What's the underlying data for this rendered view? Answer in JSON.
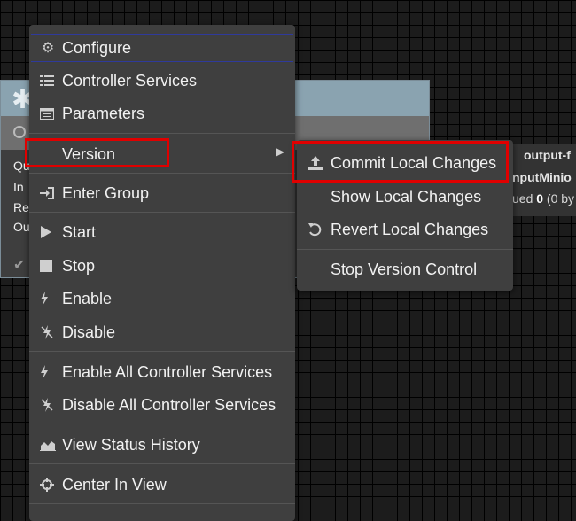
{
  "process_group": {
    "row_labels": [
      "Qu",
      "In",
      "Re",
      "Ou"
    ]
  },
  "connection": {
    "name": "output-f",
    "destination": "nputMinio",
    "queued_prefix": "ued ",
    "queued_value": "0",
    "queued_suffix": " (0 by"
  },
  "context_menu": {
    "items": [
      {
        "label": "Configure",
        "icon": "gear-icon"
      },
      {
        "label": "Controller Services",
        "icon": "list-icon"
      },
      {
        "label": "Parameters",
        "icon": "table-icon"
      },
      {
        "label": "Version",
        "icon": "none"
      },
      {
        "label": "Enter Group",
        "icon": "sign-in-icon"
      },
      {
        "label": "Start",
        "icon": "play-icon"
      },
      {
        "label": "Stop",
        "icon": "stop-icon"
      },
      {
        "label": "Enable",
        "icon": "bolt-icon"
      },
      {
        "label": "Disable",
        "icon": "bolt-slash-icon"
      },
      {
        "label": "Enable All Controller Services",
        "icon": "bolt-icon"
      },
      {
        "label": "Disable All Controller Services",
        "icon": "bolt-slash-icon"
      },
      {
        "label": "View Status History",
        "icon": "area-chart-icon"
      },
      {
        "label": "Center In View",
        "icon": "crosshairs-icon"
      }
    ]
  },
  "version_submenu": {
    "items": [
      {
        "label": "Commit Local Changes",
        "icon": "upload-icon"
      },
      {
        "label": "Show Local Changes",
        "icon": "none"
      },
      {
        "label": "Revert Local Changes",
        "icon": "undo-icon"
      },
      {
        "label": "Stop Version Control",
        "icon": "none"
      }
    ]
  },
  "colors": {
    "highlight_border": "#e00000",
    "menu_background": "#3f3f3f",
    "process_group_header": "#8aa3b0"
  }
}
